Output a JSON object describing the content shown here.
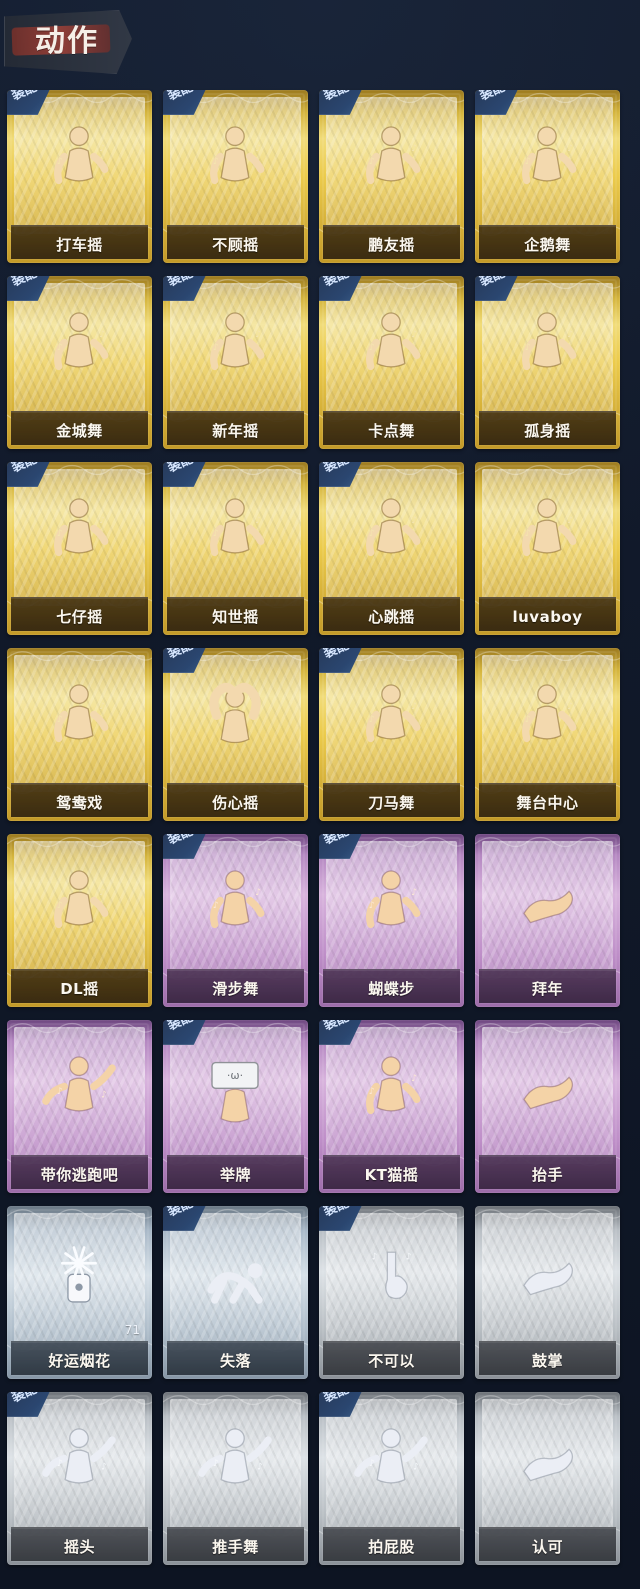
{
  "section": {
    "title": "动作"
  },
  "colors": {
    "gold": "#e8c64a",
    "purple": "#c79ad0",
    "silverblue": "#c7d4df",
    "gray": "#c9ced3",
    "equipped_tag": "#2c4a73"
  },
  "cards": [
    {
      "label": "打车摇",
      "theme": "gold",
      "equipped": true,
      "equipped_label": "装配",
      "icon": "dance-pose-icon"
    },
    {
      "label": "不顾摇",
      "theme": "gold",
      "equipped": true,
      "equipped_label": "装配",
      "icon": "dance-pose-icon"
    },
    {
      "label": "鹏友摇",
      "theme": "gold",
      "equipped": true,
      "equipped_label": "装配",
      "icon": "dance-pose-icon"
    },
    {
      "label": "企鹅舞",
      "theme": "gold",
      "equipped": true,
      "equipped_label": "装配",
      "icon": "dance-pose-icon"
    },
    {
      "label": "金城舞",
      "theme": "gold",
      "equipped": true,
      "equipped_label": "装配",
      "icon": "dance-pose-icon"
    },
    {
      "label": "新年摇",
      "theme": "gold",
      "equipped": true,
      "equipped_label": "装配",
      "icon": "dance-pose-icon"
    },
    {
      "label": "卡点舞",
      "theme": "gold",
      "equipped": true,
      "equipped_label": "装配",
      "icon": "dance-pose-icon"
    },
    {
      "label": "孤身摇",
      "theme": "gold",
      "equipped": true,
      "equipped_label": "装配",
      "icon": "dance-pose-icon"
    },
    {
      "label": "七仔摇",
      "theme": "gold",
      "equipped": true,
      "equipped_label": "装配",
      "icon": "dance-pose-icon"
    },
    {
      "label": "知世摇",
      "theme": "gold",
      "equipped": true,
      "equipped_label": "装配",
      "icon": "dance-pose-icon"
    },
    {
      "label": "心跳摇",
      "theme": "gold",
      "equipped": true,
      "equipped_label": "装配",
      "icon": "dance-pose-icon"
    },
    {
      "label": "luvaboy",
      "theme": "gold",
      "equipped": false,
      "icon": "dance-pose-icon"
    },
    {
      "label": "鸳鸯戏",
      "theme": "gold",
      "equipped": false,
      "icon": "dance-pose-icon"
    },
    {
      "label": "伤心摇",
      "theme": "gold",
      "equipped": true,
      "equipped_label": "装配",
      "icon": "heart-hands-icon"
    },
    {
      "label": "刀马舞",
      "theme": "gold",
      "equipped": true,
      "equipped_label": "装配",
      "icon": "dance-pose-icon"
    },
    {
      "label": "舞台中心",
      "theme": "gold",
      "equipped": false,
      "icon": "dance-pose-icon"
    },
    {
      "label": "DL摇",
      "theme": "gold",
      "equipped": false,
      "icon": "dance-pose-icon"
    },
    {
      "label": "滑步舞",
      "theme": "purple",
      "equipped": true,
      "equipped_label": "装配",
      "icon": "dance-pose-icon"
    },
    {
      "label": "蝴蝶步",
      "theme": "purple",
      "equipped": true,
      "equipped_label": "装配",
      "icon": "dance-pose-icon"
    },
    {
      "label": "拜年",
      "theme": "purple",
      "equipped": false,
      "icon": "greeting-icon"
    },
    {
      "label": "带你逃跑吧",
      "theme": "purple",
      "equipped": false,
      "icon": "pointing-dance-icon"
    },
    {
      "label": "举牌",
      "theme": "purple",
      "equipped": true,
      "equipped_label": "装配",
      "icon": "sign-holder-icon"
    },
    {
      "label": "KT猫摇",
      "theme": "purple",
      "equipped": true,
      "equipped_label": "装配",
      "icon": "dance-pose-icon"
    },
    {
      "label": "抬手",
      "theme": "purple",
      "equipped": false,
      "icon": "raise-hand-icon"
    },
    {
      "label": "好运烟花",
      "theme": "silverblue",
      "equipped": false,
      "icon": "firework-icon",
      "count": "71"
    },
    {
      "label": "失落",
      "theme": "silverblue",
      "equipped": true,
      "equipped_label": "装配",
      "icon": "crawl-icon"
    },
    {
      "label": "不可以",
      "theme": "gray",
      "equipped": true,
      "equipped_label": "装配",
      "icon": "finger-wag-icon"
    },
    {
      "label": "鼓掌",
      "theme": "gray",
      "equipped": false,
      "icon": "clap-icon"
    },
    {
      "label": "摇头",
      "theme": "gray",
      "equipped": true,
      "equipped_label": "装配",
      "icon": "shake-head-icon"
    },
    {
      "label": "推手舞",
      "theme": "gray",
      "equipped": false,
      "icon": "push-hands-icon"
    },
    {
      "label": "拍屁股",
      "theme": "gray",
      "equipped": true,
      "equipped_label": "装配",
      "icon": "butt-slap-icon"
    },
    {
      "label": "认可",
      "theme": "gray",
      "equipped": false,
      "icon": "thumbs-up-icon"
    }
  ]
}
